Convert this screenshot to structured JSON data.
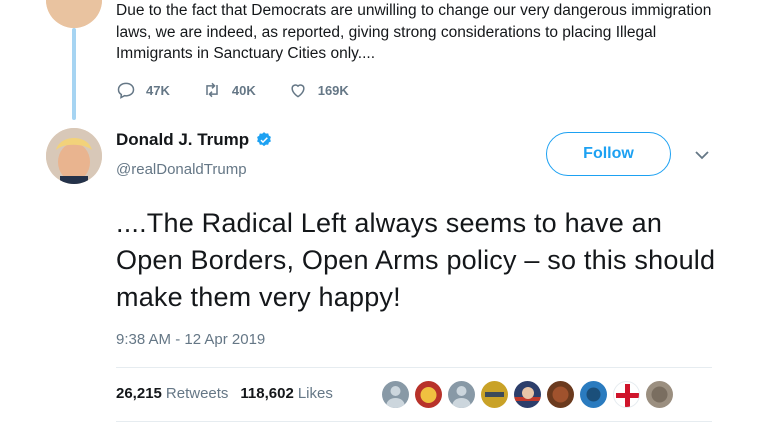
{
  "previous_tweet": {
    "text": "Due to the fact that Democrats are unwilling to change our very dangerous immigration laws, we are indeed, as reported, giving strong considerations to placing Illegal Immigrants in Sanctuary Cities only....",
    "replies": "47K",
    "retweets": "40K",
    "likes": "169K"
  },
  "tweet": {
    "author_name": "Donald J. Trump",
    "handle": "@realDonaldTrump",
    "follow_label": "Follow",
    "text": "....The Radical Left always seems to have an Open Borders, Open Arms policy – so this should make them very happy!",
    "timestamp": "9:38 AM - 12 Apr 2019",
    "retweet_count": "26,215",
    "retweet_label": "Retweets",
    "like_count": "118,602",
    "like_label": "Likes"
  },
  "colors": {
    "accent": "#1da1f2",
    "muted": "#657786",
    "thread_line": "#a6d4f2"
  },
  "icons": [
    "reply-icon",
    "retweet-icon",
    "like-icon",
    "verified-badge-icon",
    "chevron-down-icon"
  ]
}
